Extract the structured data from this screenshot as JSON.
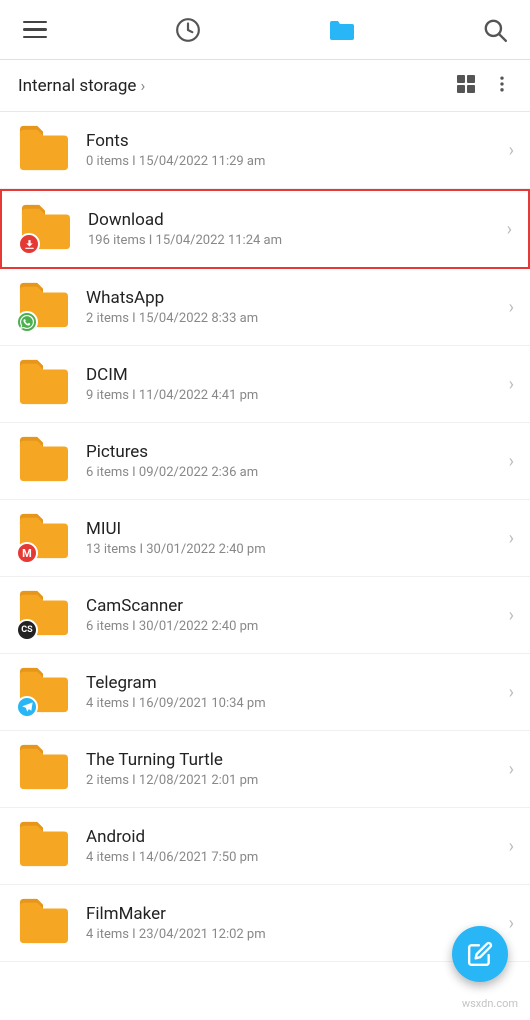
{
  "topbar": {
    "menu_label": "Menu",
    "history_label": "History",
    "folder_label": "Folder",
    "search_label": "Search"
  },
  "breadcrumb": {
    "path": "Internal storage",
    "view_grid_label": "Grid view",
    "more_label": "More options"
  },
  "folders": [
    {
      "id": 1,
      "name": "Fonts",
      "items": "0 items",
      "date": "15/04/2022 11:29 am",
      "badge_color": null,
      "badge_icon": null,
      "highlighted": false
    },
    {
      "id": 2,
      "name": "Download",
      "items": "196 items",
      "date": "15/04/2022 11:24 am",
      "badge_color": "#e53935",
      "badge_icon": "↓",
      "highlighted": true
    },
    {
      "id": 3,
      "name": "WhatsApp",
      "items": "2 items",
      "date": "15/04/2022 8:33 am",
      "badge_color": "#4caf50",
      "badge_icon": "W",
      "highlighted": false
    },
    {
      "id": 4,
      "name": "DCIM",
      "items": "9 items",
      "date": "11/04/2022 4:41 pm",
      "badge_color": null,
      "badge_icon": null,
      "highlighted": false
    },
    {
      "id": 5,
      "name": "Pictures",
      "items": "6 items",
      "date": "09/02/2022 2:36 am",
      "badge_color": null,
      "badge_icon": null,
      "highlighted": false
    },
    {
      "id": 6,
      "name": "MIUI",
      "items": "13 items",
      "date": "30/01/2022 2:40 pm",
      "badge_color": "#e53935",
      "badge_icon": "M",
      "highlighted": false
    },
    {
      "id": 7,
      "name": "CamScanner",
      "items": "6 items",
      "date": "30/01/2022 2:40 pm",
      "badge_color": "#222",
      "badge_icon": "CS",
      "highlighted": false
    },
    {
      "id": 8,
      "name": "Telegram",
      "items": "4 items",
      "date": "16/09/2021 10:34 pm",
      "badge_color": "#29b6f6",
      "badge_icon": "✈",
      "highlighted": false
    },
    {
      "id": 9,
      "name": "The Turning Turtle",
      "items": "2 items",
      "date": "12/08/2021 2:01 pm",
      "badge_color": null,
      "badge_icon": null,
      "highlighted": false
    },
    {
      "id": 10,
      "name": "Android",
      "items": "4 items",
      "date": "14/06/2021 7:50 pm",
      "badge_color": null,
      "badge_icon": null,
      "highlighted": false
    },
    {
      "id": 11,
      "name": "FilmMaker",
      "items": "4 items",
      "date": "23/04/2021 12:02 pm",
      "badge_color": null,
      "badge_icon": null,
      "highlighted": false
    }
  ],
  "fab": {
    "label": "Add"
  },
  "watermark": "wsxdn.com"
}
